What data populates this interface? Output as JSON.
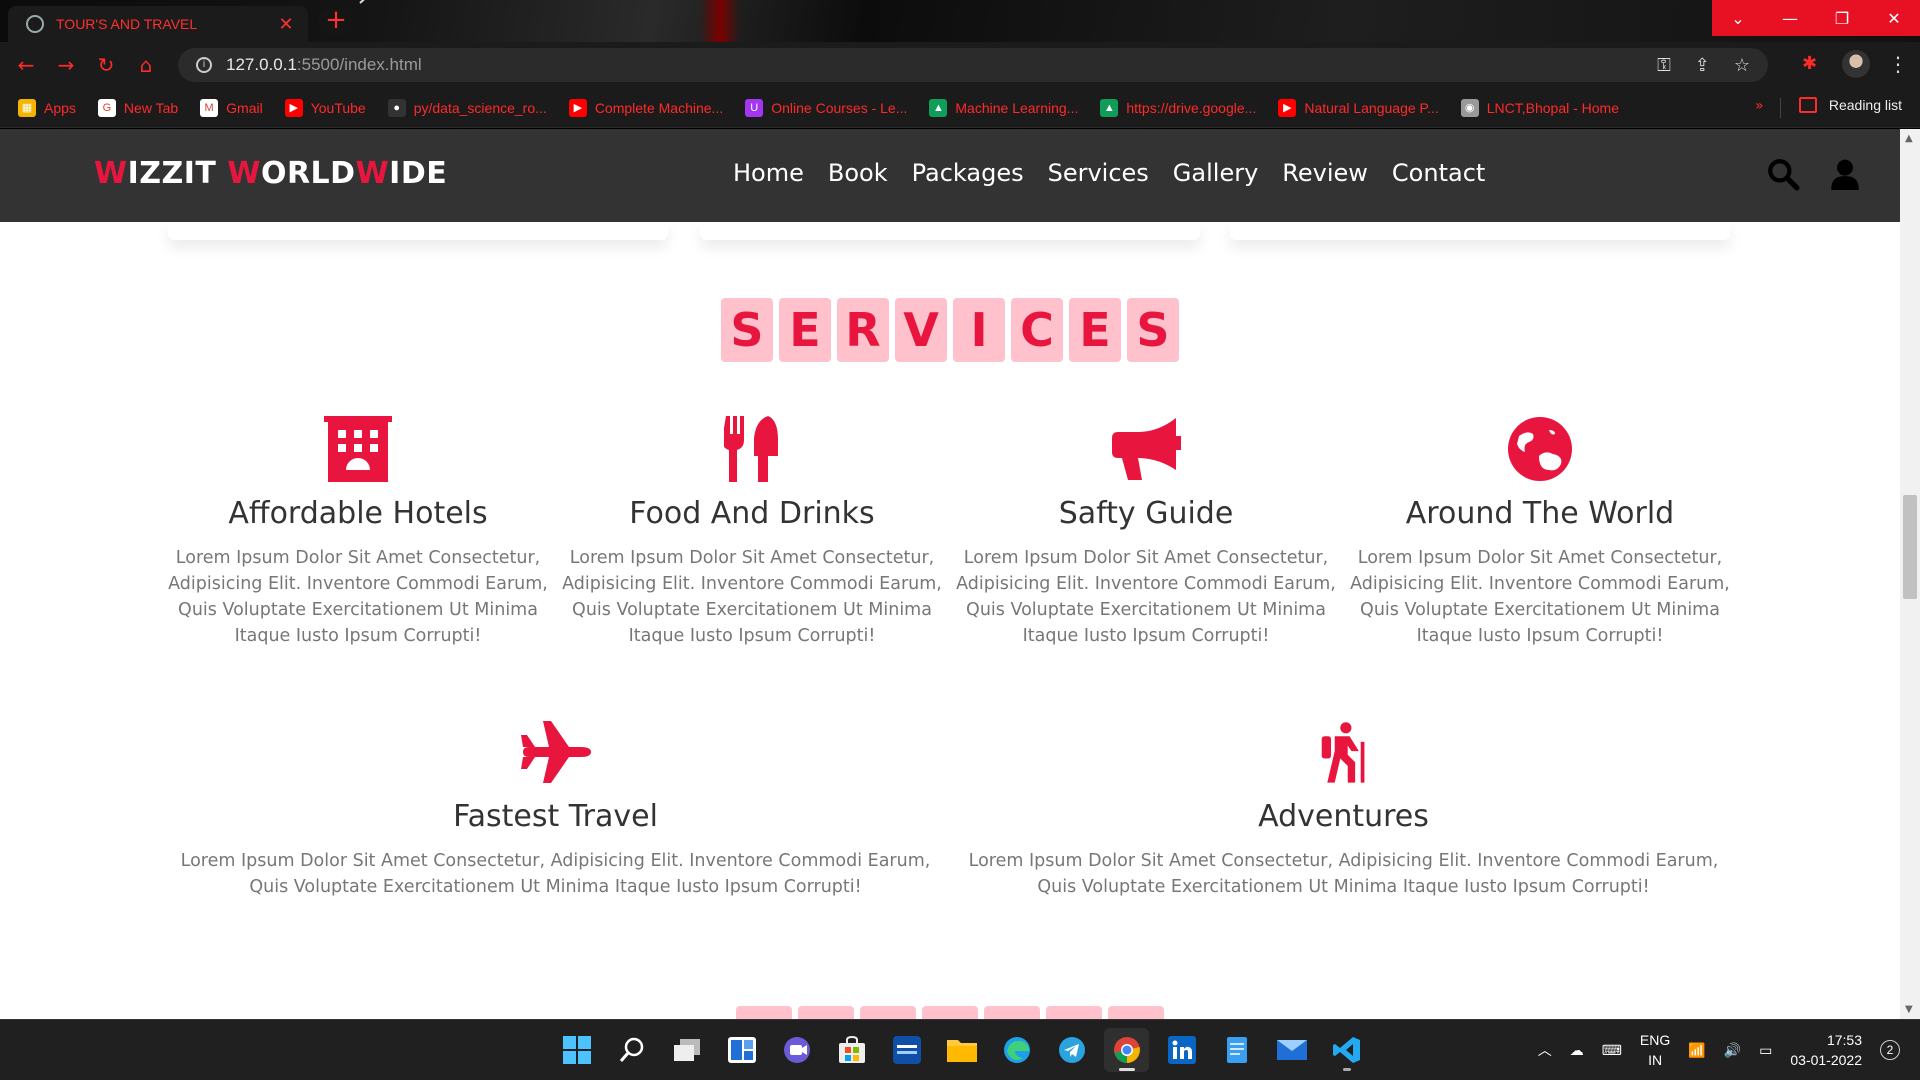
{
  "browser": {
    "tab_title": "TOUR'S AND TRAVEL",
    "url_host": "127.0.0.1",
    "url_path": ":5500/index.html",
    "bookmarks": [
      {
        "label": "Apps",
        "icon": "apps-grid-icon",
        "color": "#f4b400"
      },
      {
        "label": "New Tab",
        "icon": "google-icon",
        "color": "#ffffff"
      },
      {
        "label": "Gmail",
        "icon": "gmail-icon",
        "color": "#ffffff"
      },
      {
        "label": "YouTube",
        "icon": "youtube-icon",
        "color": "#ff0000"
      },
      {
        "label": "py/data_science_ro...",
        "icon": "github-icon",
        "color": "#333333"
      },
      {
        "label": "Complete Machine...",
        "icon": "youtube-icon",
        "color": "#ff0000"
      },
      {
        "label": "Online Courses - Le...",
        "icon": "udemy-icon",
        "color": "#a435f0"
      },
      {
        "label": "Machine Learning...",
        "icon": "drive-icon",
        "color": "#0f9d58"
      },
      {
        "label": "https://drive.google...",
        "icon": "drive-icon",
        "color": "#0f9d58"
      },
      {
        "label": "Natural Language P...",
        "icon": "youtube-icon",
        "color": "#ff0000"
      },
      {
        "label": "LNCT,Bhopal - Home",
        "icon": "college-icon",
        "color": "#999999"
      }
    ],
    "reading_list": "Reading list"
  },
  "site": {
    "logo": {
      "p1": "W",
      "p2": "IZZIT ",
      "p3": "W",
      "p4": "ORLD",
      "p5": "W",
      "p6": "IDE"
    },
    "nav": [
      "Home",
      "Book",
      "Packages",
      "Services",
      "Gallery",
      "Review",
      "Contact"
    ],
    "accent": "#e8163f",
    "heading_letters": [
      "S",
      "E",
      "R",
      "V",
      "I",
      "C",
      "E",
      "S"
    ],
    "services": [
      {
        "title": "Affordable Hotels",
        "icon": "hotel-icon",
        "text": "Lorem Ipsum Dolor Sit Amet Consectetur, Adipisicing Elit. Inventore Commodi Earum, Quis Voluptate Exercitationem Ut Minima Itaque Iusto Ipsum Corrupti!"
      },
      {
        "title": "Food And Drinks",
        "icon": "utensils-icon",
        "text": "Lorem Ipsum Dolor Sit Amet Consectetur, Adipisicing Elit. Inventore Commodi Earum, Quis Voluptate Exercitationem Ut Minima Itaque Iusto Ipsum Corrupti!"
      },
      {
        "title": "Safty Guide",
        "icon": "bullhorn-icon",
        "text": "Lorem Ipsum Dolor Sit Amet Consectetur, Adipisicing Elit. Inventore Commodi Earum, Quis Voluptate Exercitationem Ut Minima Itaque Iusto Ipsum Corrupti!"
      },
      {
        "title": "Around The World",
        "icon": "globe-icon",
        "text": "Lorem Ipsum Dolor Sit Amet Consectetur, Adipisicing Elit. Inventore Commodi Earum, Quis Voluptate Exercitationem Ut Minima Itaque Iusto Ipsum Corrupti!"
      },
      {
        "title": "Fastest Travel",
        "icon": "plane-icon",
        "text": "Lorem Ipsum Dolor Sit Amet Consectetur, Adipisicing Elit. Inventore Commodi Earum, Quis Voluptate Exercitationem Ut Minima Itaque Iusto Ipsum Corrupti!"
      },
      {
        "title": "Adventures",
        "icon": "hiking-icon",
        "text": "Lorem Ipsum Dolor Sit Amet Consectetur, Adipisicing Elit. Inventore Commodi Earum, Quis Voluptate Exercitationem Ut Minima Itaque Iusto Ipsum Corrupti!"
      }
    ]
  },
  "taskbar": {
    "lang1": "ENG",
    "lang2": "IN",
    "time": "17:53",
    "date": "03-01-2022",
    "notifications": "2"
  }
}
